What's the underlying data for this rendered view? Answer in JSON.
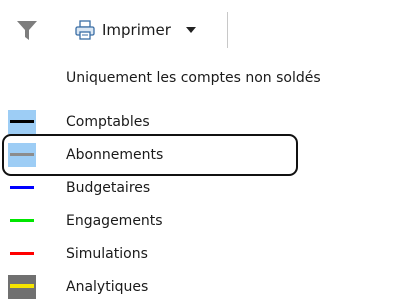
{
  "toolbar": {
    "filter_icon": "funnel-icon",
    "print_icon": "printer-icon",
    "print_label": "Imprimer",
    "caret_icon": "caret-down-icon"
  },
  "menu": {
    "option_unsettled_only": "Uniquement les comptes non soldés",
    "items": [
      {
        "label": "Comptables",
        "color": "#000000",
        "checked": true
      },
      {
        "label": "Abonnements",
        "color": "#8c8c8c",
        "checked": true,
        "highlighted": true
      },
      {
        "label": "Budgetaires",
        "color": "#0000ff",
        "checked": false
      },
      {
        "label": "Engagements",
        "color": "#00e600",
        "checked": false
      },
      {
        "label": "Simulations",
        "color": "#ff0000",
        "checked": false
      },
      {
        "label": "Analytiques",
        "color": "#f5e400",
        "checked": true
      }
    ],
    "colors": {
      "checked_background": "#9dcdf5",
      "analytic_swatch_background": "#707070",
      "highlight_border": "#111111"
    }
  }
}
